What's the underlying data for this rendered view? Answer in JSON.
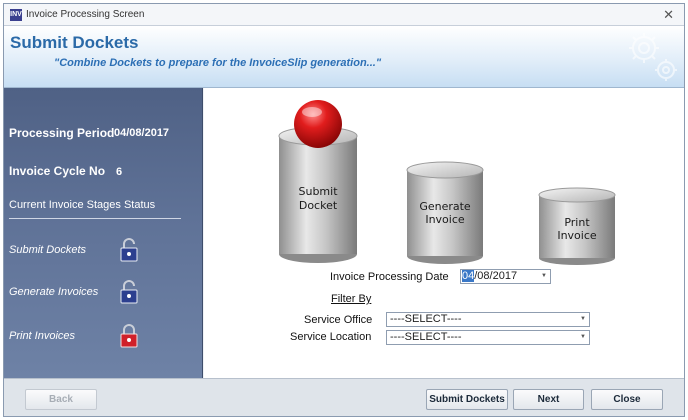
{
  "window": {
    "title": "Invoice Processing Screen",
    "app_icon_text": "INV"
  },
  "header": {
    "title": "Submit Dockets",
    "subtitle": "\"Combine Dockets to prepare for the InvoiceSlip generation...\""
  },
  "sidebar": {
    "processing_period_label": "Processing Period",
    "processing_period_value": "04/08/2017",
    "invoice_cycle_label": "Invoice Cycle No",
    "invoice_cycle_value": "6",
    "stages_status_label": "Current Invoice Stages Status",
    "stages": [
      {
        "label": "Submit Dockets",
        "lock": "unlocked",
        "lock_color": "#2c3f8f"
      },
      {
        "label": "Generate Invoices",
        "lock": "unlocked",
        "lock_color": "#2c3f8f"
      },
      {
        "label": "Print Invoices",
        "lock": "locked",
        "lock_color": "#d0202a"
      }
    ]
  },
  "stages_graphic": {
    "cylinders": [
      {
        "line1": "Submit",
        "line2": "Docket",
        "active": true
      },
      {
        "line1": "Generate",
        "line2": "Invoice",
        "active": false
      },
      {
        "line1": "Print",
        "line2": "Invoice",
        "active": false
      }
    ],
    "active_button_color": "#d41515"
  },
  "form": {
    "invoice_date_label": "Invoice Processing Date",
    "invoice_date_day": "04",
    "invoice_date_rest": "/08/2017",
    "filter_by_label": "Filter By",
    "service_office_label": "Service Office",
    "service_office_value": "----SELECT----",
    "service_location_label": "Service Location",
    "service_location_value": "----SELECT----"
  },
  "footer": {
    "back_label": "Back",
    "submit_label": "Submit Dockets",
    "next_label": "Next",
    "close_label": "Close"
  },
  "icons": {
    "close": "close-icon",
    "gears": "gears-icon",
    "lock": "padlock-icon",
    "dropdown": "chevron-down-icon"
  }
}
